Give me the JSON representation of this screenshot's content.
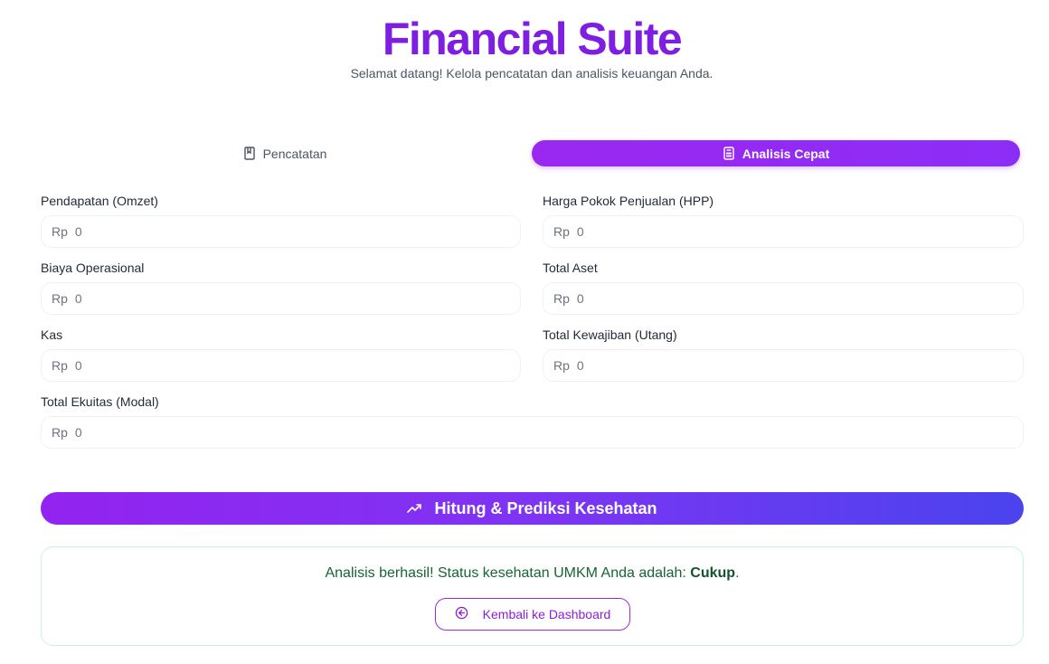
{
  "header": {
    "title": "Financial Suite",
    "subtitle": "Selamat datang! Kelola pencatatan dan analisis keuangan Anda."
  },
  "tabs": [
    {
      "label": "Pencatatan",
      "icon": "book-icon",
      "active": false
    },
    {
      "label": "Analisis Cepat",
      "icon": "calculator-icon",
      "active": true
    }
  ],
  "form": {
    "currency_prefix": "Rp",
    "fields": [
      {
        "label": "Pendapatan (Omzet)",
        "value": "",
        "placeholder": "0"
      },
      {
        "label": "Harga Pokok Penjualan (HPP)",
        "value": "",
        "placeholder": "0"
      },
      {
        "label": "Biaya Operasional",
        "value": "",
        "placeholder": "0"
      },
      {
        "label": "Total Aset",
        "value": "",
        "placeholder": "0"
      },
      {
        "label": "Kas",
        "value": "",
        "placeholder": "0"
      },
      {
        "label": "Total Kewajiban (Utang)",
        "value": "",
        "placeholder": "0"
      },
      {
        "label": "Total Ekuitas (Modal)",
        "value": "",
        "placeholder": "0"
      }
    ]
  },
  "actions": {
    "calculate_label": "Hitung & Prediksi Kesehatan",
    "calculate_icon": "trending-up-icon"
  },
  "result": {
    "message": "Analisis berhasil! Status kesehatan UMKM Anda adalah:",
    "status": "Cukup",
    "period": ".",
    "back_label": "Kembali ke Dashboard",
    "back_icon": "arrow-left-circle-icon"
  },
  "colors": {
    "brand": "#7e1ee0",
    "accent_gradient_start": "#9323f0",
    "accent_gradient_end": "#4a43ee",
    "success_text": "#166534",
    "success_border": "#c9f1e6"
  }
}
